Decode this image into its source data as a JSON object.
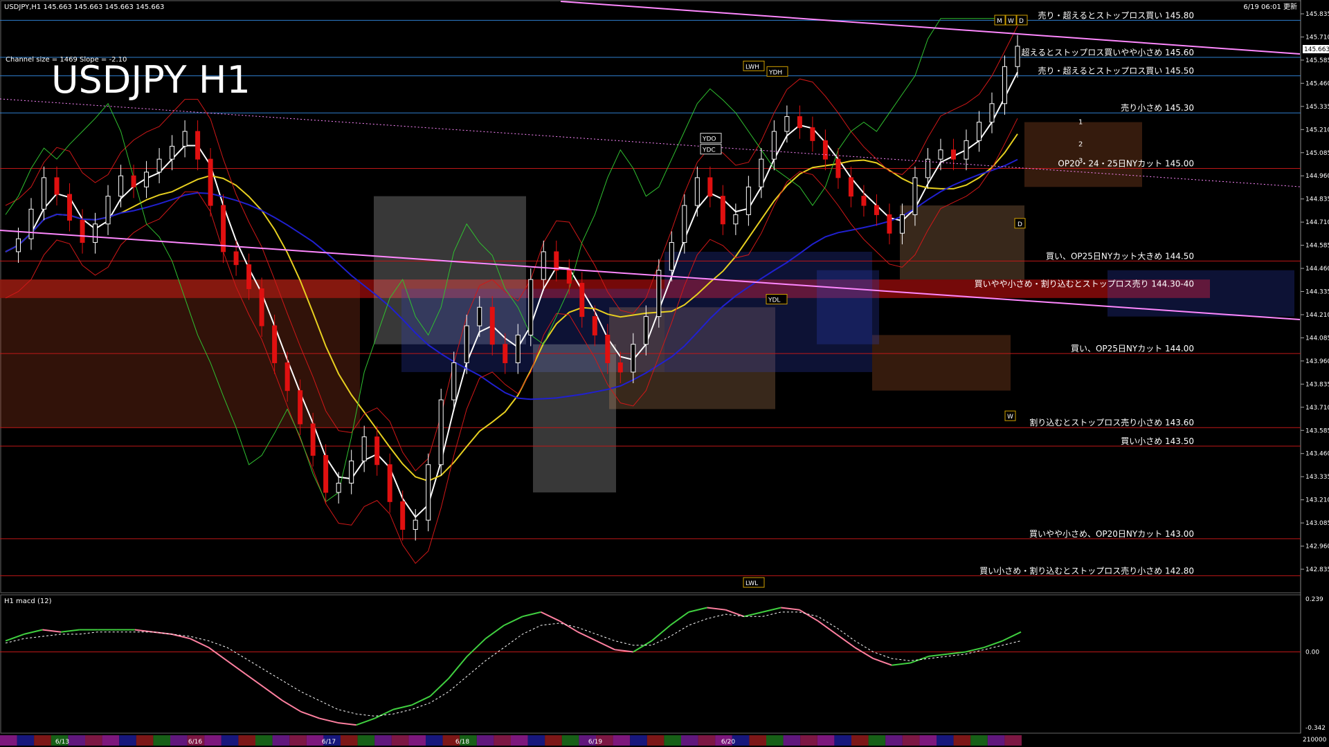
{
  "window": {
    "symbol_header": "USDJPY,H1  145.663 145.663 145.663 145.663",
    "timestamp": "6/19 06:01 更新",
    "channel_info": "Channel size = 1469 Slope = -2.10",
    "big_title": "USDJPY H1",
    "price_box": "145.663",
    "markers_top": [
      "M",
      "W",
      "D"
    ],
    "marker_d": "D",
    "marker_w": "W"
  },
  "chart_data": {
    "type": "line",
    "title": "USDJPY H1",
    "price_axis": {
      "min": 142.7,
      "max": 145.9,
      "ticks": [
        "145.835",
        "145.710",
        "145.585",
        "145.460",
        "145.335",
        "145.210",
        "145.085",
        "144.960",
        "144.835",
        "144.710",
        "144.585",
        "144.460",
        "144.335",
        "144.210",
        "144.085",
        "143.960",
        "143.835",
        "143.710",
        "143.585",
        "143.460",
        "143.335",
        "143.210",
        "143.085",
        "142.960",
        "142.835"
      ]
    },
    "date_labels": [
      "6/13",
      "6/16",
      "6/17",
      "6/18",
      "6/19",
      "6/20"
    ],
    "tag_labels": [
      "LWH",
      "YDH",
      "YDO",
      "YDC",
      "YDL",
      "LWL"
    ],
    "line_labels": [
      "1",
      "2",
      "3"
    ],
    "levels": [
      {
        "label": "売り・超えるとストップロス買い 145.80",
        "price": 145.8,
        "color": "#2f7fd0"
      },
      {
        "label": "超えるとストップロス買いやや小さめ 145.60",
        "price": 145.6,
        "color": "#2f7fd0"
      },
      {
        "label": "売り・超えるとストップロス買い 145.50",
        "price": 145.5,
        "color": "#2f7fd0"
      },
      {
        "label": "売り小さめ 145.30",
        "price": 145.3,
        "color": "#2f7fd0"
      },
      {
        "label": "OP20・24・25日NYカット 145.00",
        "price": 145.0,
        "color": "#c01818"
      },
      {
        "label": "買い、OP25日NYカット大きめ 144.50",
        "price": 144.5,
        "color": "#c01818"
      },
      {
        "label": "買いやや小さめ・割り込むとストップロス売り 144.30-40",
        "price": 144.35,
        "color": "#c01818",
        "band": true
      },
      {
        "label": "買い、OP25日NYカット 144.00",
        "price": 144.0,
        "color": "#c01818"
      },
      {
        "label": "割り込むとストップロス売り小さめ 143.60",
        "price": 143.6,
        "color": "#c01818"
      },
      {
        "label": "買い小さめ 143.50",
        "price": 143.5,
        "color": "#c01818"
      },
      {
        "label": "買いやや小さめ、OP20日NYカット 143.00",
        "price": 143.0,
        "color": "#c01818"
      },
      {
        "label": "買い小さめ・割り込むとストップロス売り小さめ 142.80",
        "price": 142.8,
        "color": "#c01818"
      }
    ],
    "price_series": [
      144.55,
      144.62,
      144.78,
      144.95,
      144.86,
      144.72,
      144.6,
      144.7,
      144.85,
      144.96,
      144.9,
      144.98,
      145.05,
      145.12,
      145.2,
      145.05,
      144.8,
      144.55,
      144.48,
      144.35,
      144.15,
      143.95,
      143.8,
      143.62,
      143.45,
      143.25,
      143.3,
      143.42,
      143.55,
      143.4,
      143.2,
      143.05,
      143.1,
      143.4,
      143.75,
      143.95,
      144.15,
      144.25,
      144.05,
      143.95,
      144.1,
      144.4,
      144.55,
      144.45,
      144.38,
      144.2,
      144.1,
      143.95,
      143.9,
      144.05,
      144.2,
      144.45,
      144.6,
      144.8,
      144.95,
      144.85,
      144.7,
      144.75,
      144.9,
      145.05,
      145.2,
      145.28,
      145.22,
      145.15,
      145.05,
      144.95,
      144.85,
      144.8,
      144.75,
      144.65,
      144.75,
      144.95,
      145.05,
      145.1,
      145.05,
      145.15,
      145.25,
      145.35,
      145.55,
      145.66
    ],
    "macd": {
      "label": "H1 macd (12)",
      "axis_ticks": [
        "0.239",
        "0.00",
        "-0.342"
      ],
      "axis_max": 0.239,
      "axis_min": -0.342,
      "volume_label": "210000",
      "main": [
        0.05,
        0.08,
        0.1,
        0.09,
        0.1,
        0.1,
        0.1,
        0.1,
        0.09,
        0.08,
        0.06,
        0.02,
        -0.04,
        -0.1,
        -0.16,
        -0.22,
        -0.27,
        -0.3,
        -0.32,
        -0.33,
        -0.3,
        -0.26,
        -0.24,
        -0.2,
        -0.12,
        -0.02,
        0.06,
        0.12,
        0.16,
        0.18,
        0.14,
        0.09,
        0.05,
        0.01,
        0.0,
        0.05,
        0.12,
        0.18,
        0.2,
        0.19,
        0.16,
        0.18,
        0.2,
        0.19,
        0.14,
        0.08,
        0.02,
        -0.03,
        -0.06,
        -0.05,
        -0.02,
        -0.01,
        0.0,
        0.02,
        0.05,
        0.09
      ],
      "signal": [
        0.04,
        0.06,
        0.07,
        0.08,
        0.08,
        0.09,
        0.09,
        0.09,
        0.09,
        0.08,
        0.07,
        0.05,
        0.02,
        -0.03,
        -0.08,
        -0.13,
        -0.18,
        -0.22,
        -0.26,
        -0.28,
        -0.29,
        -0.28,
        -0.26,
        -0.23,
        -0.18,
        -0.11,
        -0.04,
        0.02,
        0.08,
        0.12,
        0.13,
        0.11,
        0.08,
        0.05,
        0.03,
        0.03,
        0.07,
        0.12,
        0.15,
        0.17,
        0.16,
        0.16,
        0.18,
        0.18,
        0.16,
        0.11,
        0.05,
        0.0,
        -0.03,
        -0.04,
        -0.03,
        -0.02,
        -0.01,
        0.01,
        0.03,
        0.05
      ]
    }
  },
  "colors": {
    "bg": "#000000",
    "bull": "#ffffff",
    "bear": "#e01010",
    "ma_white": "#ffffff",
    "ma_yellow": "#e8d020",
    "ma_blue": "#2020d0",
    "green": "#30c030",
    "pink": "#ff88ff",
    "macd_up": "#40d040",
    "macd_down": "#ff80a0"
  }
}
